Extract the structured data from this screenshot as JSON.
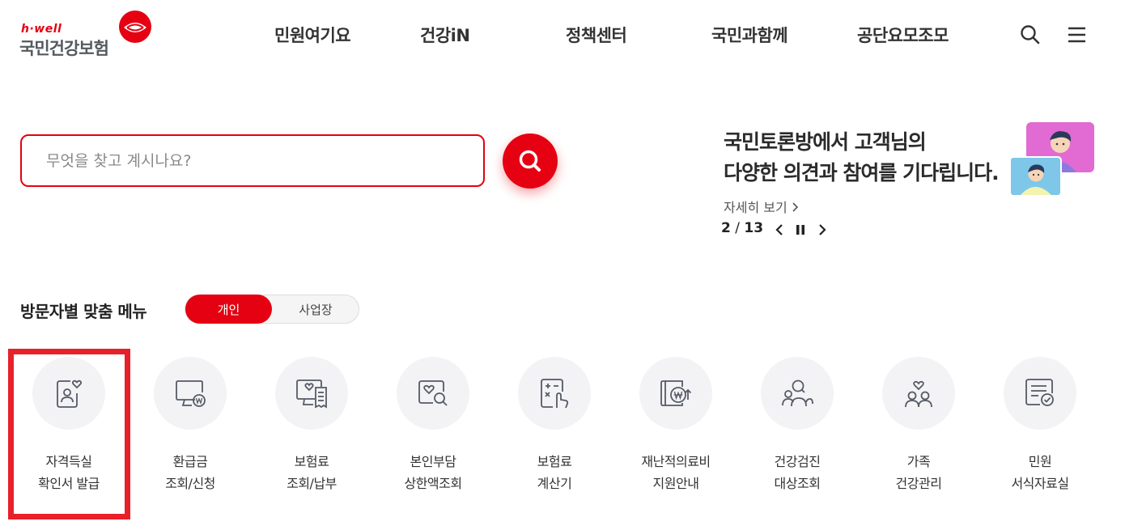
{
  "header": {
    "logo_tagline": "h·well",
    "logo_name": "국민건강보험",
    "nav": [
      "민원여기요",
      "건강iN",
      "정책센터",
      "국민과함께",
      "공단요모조모"
    ],
    "icons": [
      "search-icon",
      "hamburger-menu-icon"
    ]
  },
  "search": {
    "placeholder": "무엇을 찾고 계시나요?",
    "button_icon": "search-icon"
  },
  "banner": {
    "line1": "국민토론방에서 고객님의",
    "line2": "다양한 의견과 참여를 기다립니다.",
    "more_link": "자세히 보기",
    "current": "2",
    "separator": "/",
    "total": "13"
  },
  "visitor_menu": {
    "title": "방문자별 맞춤 메뉴",
    "tabs": [
      "개인",
      "사업장"
    ],
    "active_tab": "개인",
    "items": [
      {
        "line1": "자격득실",
        "line2": "확인서 발급",
        "icon": "id-card-heart-icon"
      },
      {
        "line1": "환급금",
        "line2": "조회/신청",
        "icon": "monitor-won-icon"
      },
      {
        "line1": "보험료",
        "line2": "조회/납부",
        "icon": "monitor-receipt-icon"
      },
      {
        "line1": "본인부담",
        "line2": "상한액조회",
        "icon": "heart-search-icon"
      },
      {
        "line1": "보험료",
        "line2": "계산기",
        "icon": "calculator-hand-icon"
      },
      {
        "line1": "재난적의료비",
        "line2": "지원안내",
        "icon": "won-card-icon"
      },
      {
        "line1": "건강검진",
        "line2": "대상조회",
        "icon": "people-search-icon"
      },
      {
        "line1": "가족",
        "line2": "건강관리",
        "icon": "family-heart-icon"
      },
      {
        "line1": "민원",
        "line2": "서식자료실",
        "icon": "document-check-icon"
      }
    ]
  },
  "colors": {
    "brand_red": "#e50012",
    "highlight_red": "#e8202a",
    "icon_gray": "#555a66",
    "circle_bg": "#f3f3f5"
  }
}
